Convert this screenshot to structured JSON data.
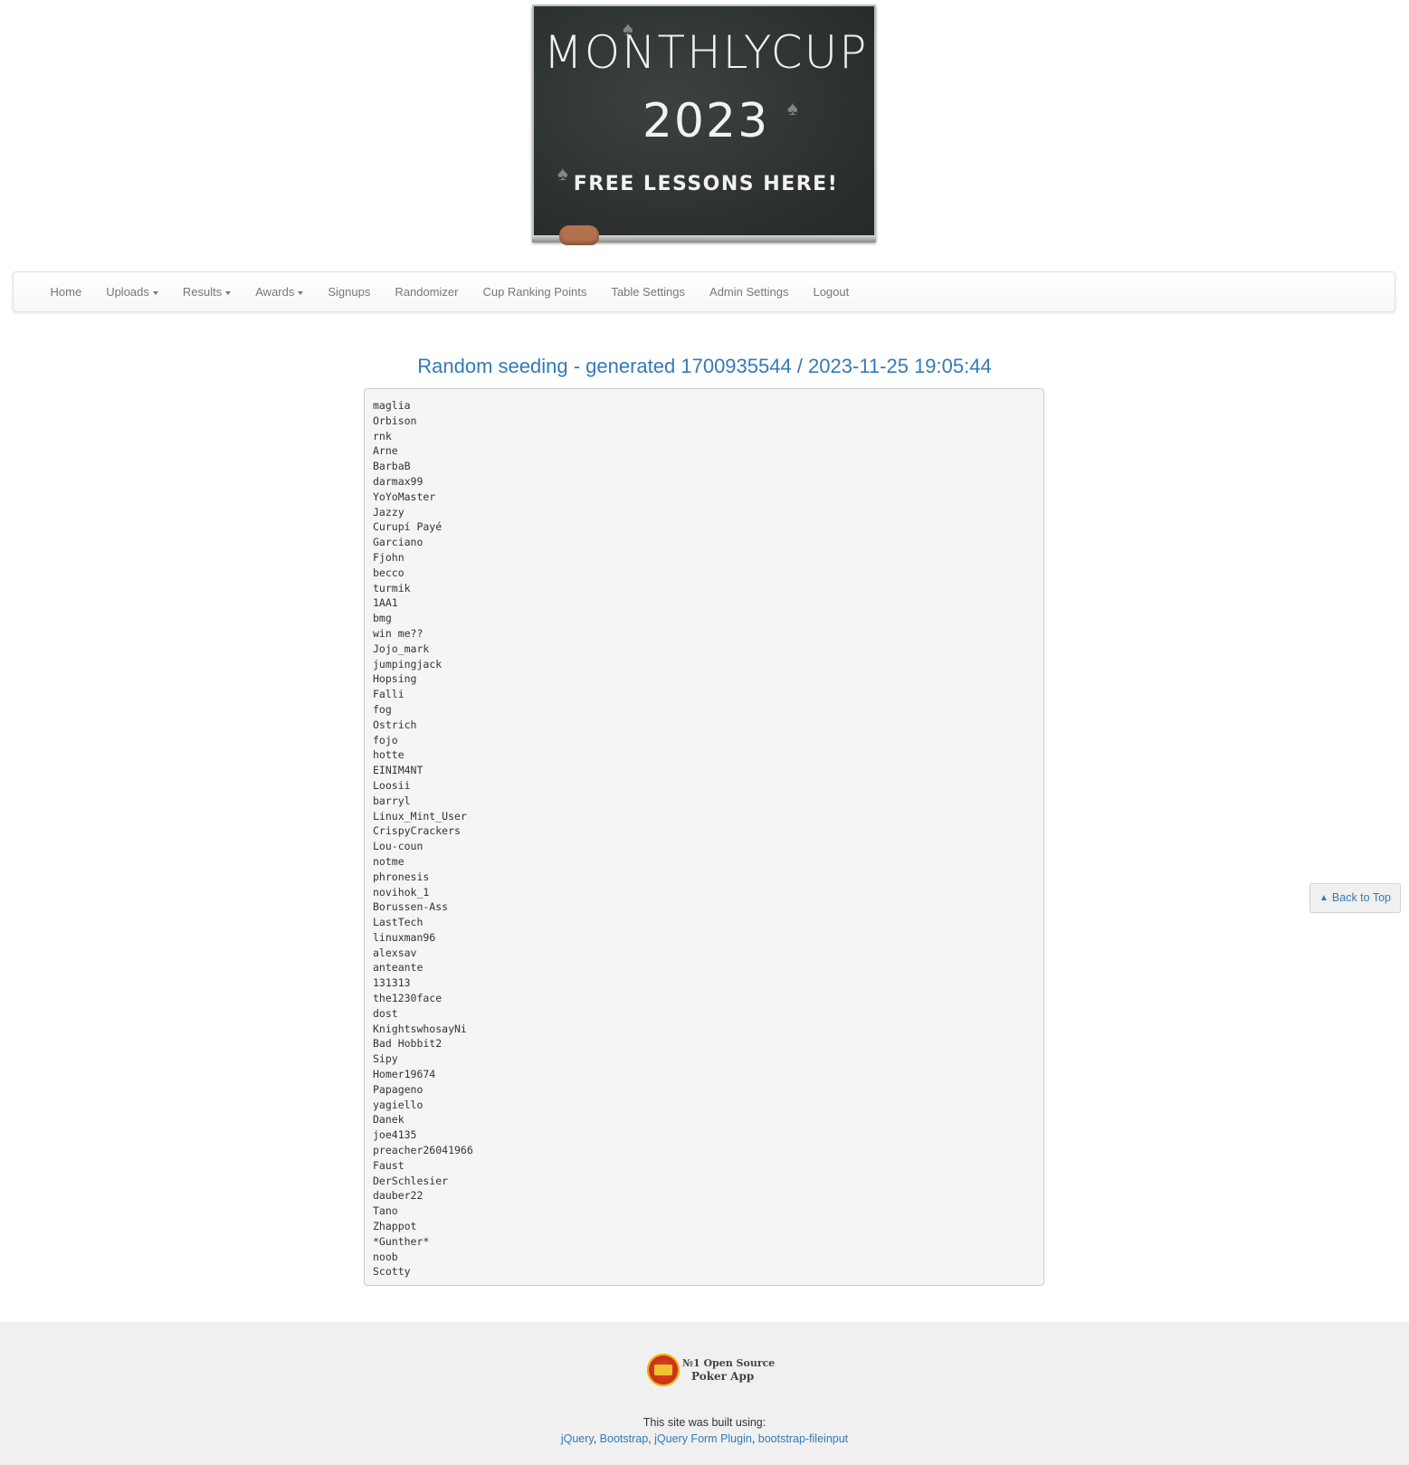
{
  "banner": {
    "line1": "MONTHLYCUP",
    "line2": "2023",
    "line3": "FREE LESSONS HERE!"
  },
  "nav": {
    "items": [
      {
        "label": "Home",
        "dropdown": false
      },
      {
        "label": "Uploads",
        "dropdown": true
      },
      {
        "label": "Results",
        "dropdown": true
      },
      {
        "label": "Awards",
        "dropdown": true
      },
      {
        "label": "Signups",
        "dropdown": false
      },
      {
        "label": "Randomizer",
        "dropdown": false
      },
      {
        "label": "Cup Ranking Points",
        "dropdown": false
      },
      {
        "label": "Table Settings",
        "dropdown": false
      },
      {
        "label": "Admin Settings",
        "dropdown": false
      },
      {
        "label": "Logout",
        "dropdown": false
      }
    ]
  },
  "main": {
    "title": "Random seeding - generated 1700935544 / 2023-11-25 19:05:44",
    "players": [
      "maglia",
      "Orbison",
      "rnk",
      "Arne",
      "BarbaB",
      "darmax99",
      "YoYoMaster",
      "Jazzy",
      "Curupí Payé",
      "Garciano",
      "Fjohn",
      "becco",
      "turmik",
      "1AA1",
      "bmg",
      "win me??",
      "Jojo_mark",
      "jumpingjack",
      "Hopsing",
      "Falli",
      "fog",
      "Ostrich",
      "fojo",
      "hotte",
      "EINIM4NT",
      "Loosii",
      "barryl",
      "Linux_Mint_User",
      "CrispyCrackers",
      "Lou-coun",
      "notme",
      "phronesis",
      "novihok_1",
      "Borussen-Ass",
      "LastTech",
      "linuxman96",
      "alexsav",
      "anteante",
      "131313",
      "the1230face",
      "dost",
      "KnightswhosayNi",
      "Bad Hobbit2",
      "Sipy",
      "Homer19674",
      "Papageno",
      "yagiello",
      "Danek",
      "joe4135",
      "preacher26041966",
      "Faust",
      "DerSchlesier",
      "dauber22",
      "Tano",
      "Zhappot",
      "*Gunther*",
      "noob",
      "Scotty"
    ]
  },
  "back_to_top": {
    "label": "Back to Top",
    "icon": "chevron-up-icon"
  },
  "footer": {
    "logo_line1": "№1 Open Source",
    "logo_line2": "Poker App",
    "built_using": "This site was built using:",
    "credits": [
      "jQuery",
      "Bootstrap",
      "jQuery Form Plugin",
      "bootstrap-fileinput"
    ],
    "separator": ", "
  },
  "colors": {
    "link": "#337ab7",
    "nav_text": "#777777",
    "pre_bg": "#f5f5f5",
    "footer_bg": "#f0f0f0"
  }
}
